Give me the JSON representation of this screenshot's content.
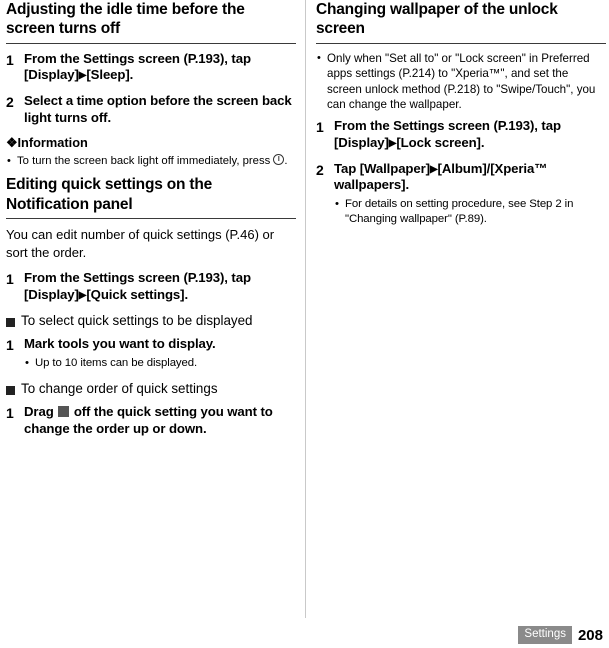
{
  "left_column": {
    "section1": {
      "title": "Adjusting the idle time before the screen turns off",
      "steps": [
        {
          "num": "1",
          "text_a": "From the Settings screen (P.193), tap [Display]",
          "arrow": "▶",
          "text_b": "[Sleep]."
        },
        {
          "num": "2",
          "text_a": "Select a time option before the screen back light turns off.",
          "arrow": "",
          "text_b": ""
        }
      ],
      "info_heading": "❖Information",
      "info_bullets": [
        "To turn the screen back light off immediately, press"
      ],
      "info_bullet_tail": "."
    },
    "section2": {
      "title": "Editing quick settings on the Notification panel",
      "body": "You can edit number of quick settings (P.46) or sort the order.",
      "steps": [
        {
          "num": "1",
          "text_a": "From the Settings screen (P.193), tap [Display]",
          "arrow": "▶",
          "text_b": "[Quick settings]."
        }
      ],
      "subhead_1": "To select quick settings to be displayed",
      "step_sub1": {
        "num": "1",
        "text": "Mark tools you want to display.",
        "sub_bullets": [
          "Up to 10 items can be displayed."
        ]
      },
      "subhead_2": "To change order of quick settings",
      "step_sub2": {
        "num": "1",
        "text_a": "Drag",
        "text_b": "off the quick setting you want to change the order up or down."
      }
    }
  },
  "right_column": {
    "section1": {
      "title": "Changing wallpaper of the unlock screen",
      "bullets": [
        "Only when \"Set all to\" or \"Lock screen\" in Preferred apps settings (P.214) to \"Xperia™\", and set the screen unlock method (P.218) to \"Swipe/Touch\", you can change the wallpaper."
      ],
      "steps": [
        {
          "num": "1",
          "text_a": "From the Settings screen (P.193), tap [Display]",
          "arrow": "▶",
          "text_b": "[Lock screen]."
        },
        {
          "num": "2",
          "text_a": "Tap [Wallpaper]",
          "arrow": "▶",
          "text_b": "[Album]/[Xperia™ wallpapers].",
          "sub_bullets": [
            "For details on setting procedure, see Step 2 in \"Changing wallpaper\" (P.89)."
          ]
        }
      ]
    }
  },
  "footer": {
    "label": "Settings",
    "page": "208"
  }
}
